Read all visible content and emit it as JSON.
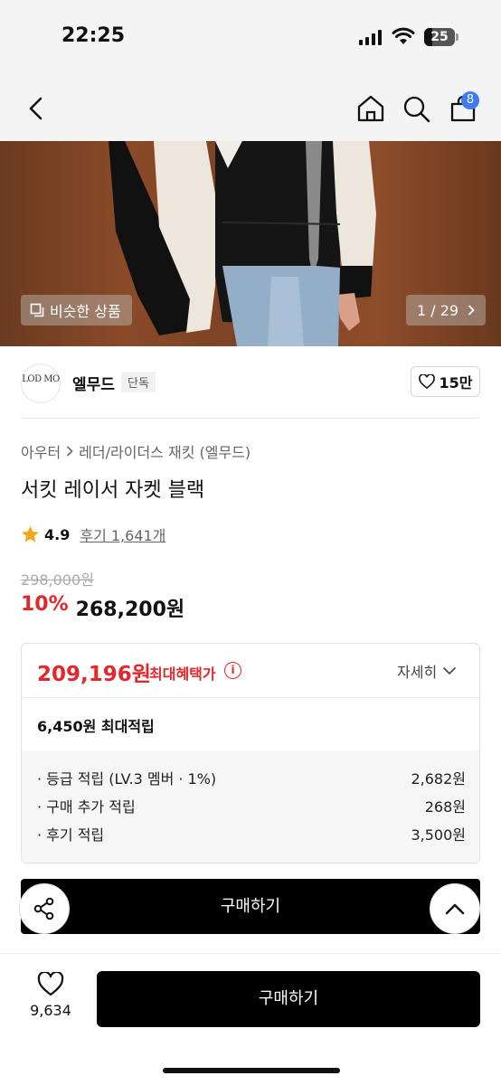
{
  "status": {
    "time": "22:25",
    "battery": "25"
  },
  "nav": {
    "cart_count": "8"
  },
  "hero": {
    "similar_label": "비슷한 상품",
    "page_indicator": "1 / 29"
  },
  "brand": {
    "logo_text": "LOD MO",
    "name": "엘무드",
    "tag": "단독",
    "likes": "15만"
  },
  "product": {
    "breadcrumb": [
      "아우터",
      "레더/라이더스 재킷 (엘무드)"
    ],
    "title": "서킷 레이서 자켓 블랙",
    "rating": "4.9",
    "reviews": "후기 1,641개",
    "original_price": "298,000원",
    "discount": "10%",
    "price": "268,200원"
  },
  "benefit": {
    "best_price": "209,196원",
    "best_label": "최대혜택가",
    "info": "i",
    "detail_label": "자세히",
    "points_total": "6,450원 최대적립",
    "rows": [
      {
        "label": "· 등급 적립 (LV.3 멤버 · 1%)",
        "value": "2,682원"
      },
      {
        "label": "· 구매 추가 적립",
        "value": "268원"
      },
      {
        "label": "· 후기 적립",
        "value": "3,500원"
      }
    ]
  },
  "buy_inline_label": "구매하기",
  "bottom": {
    "wish_count": "9,634",
    "buy_label": "구매하기"
  },
  "colors": {
    "accent_red": "#e2282c",
    "badge_blue": "#3d7cf0",
    "button_black": "#000000"
  }
}
